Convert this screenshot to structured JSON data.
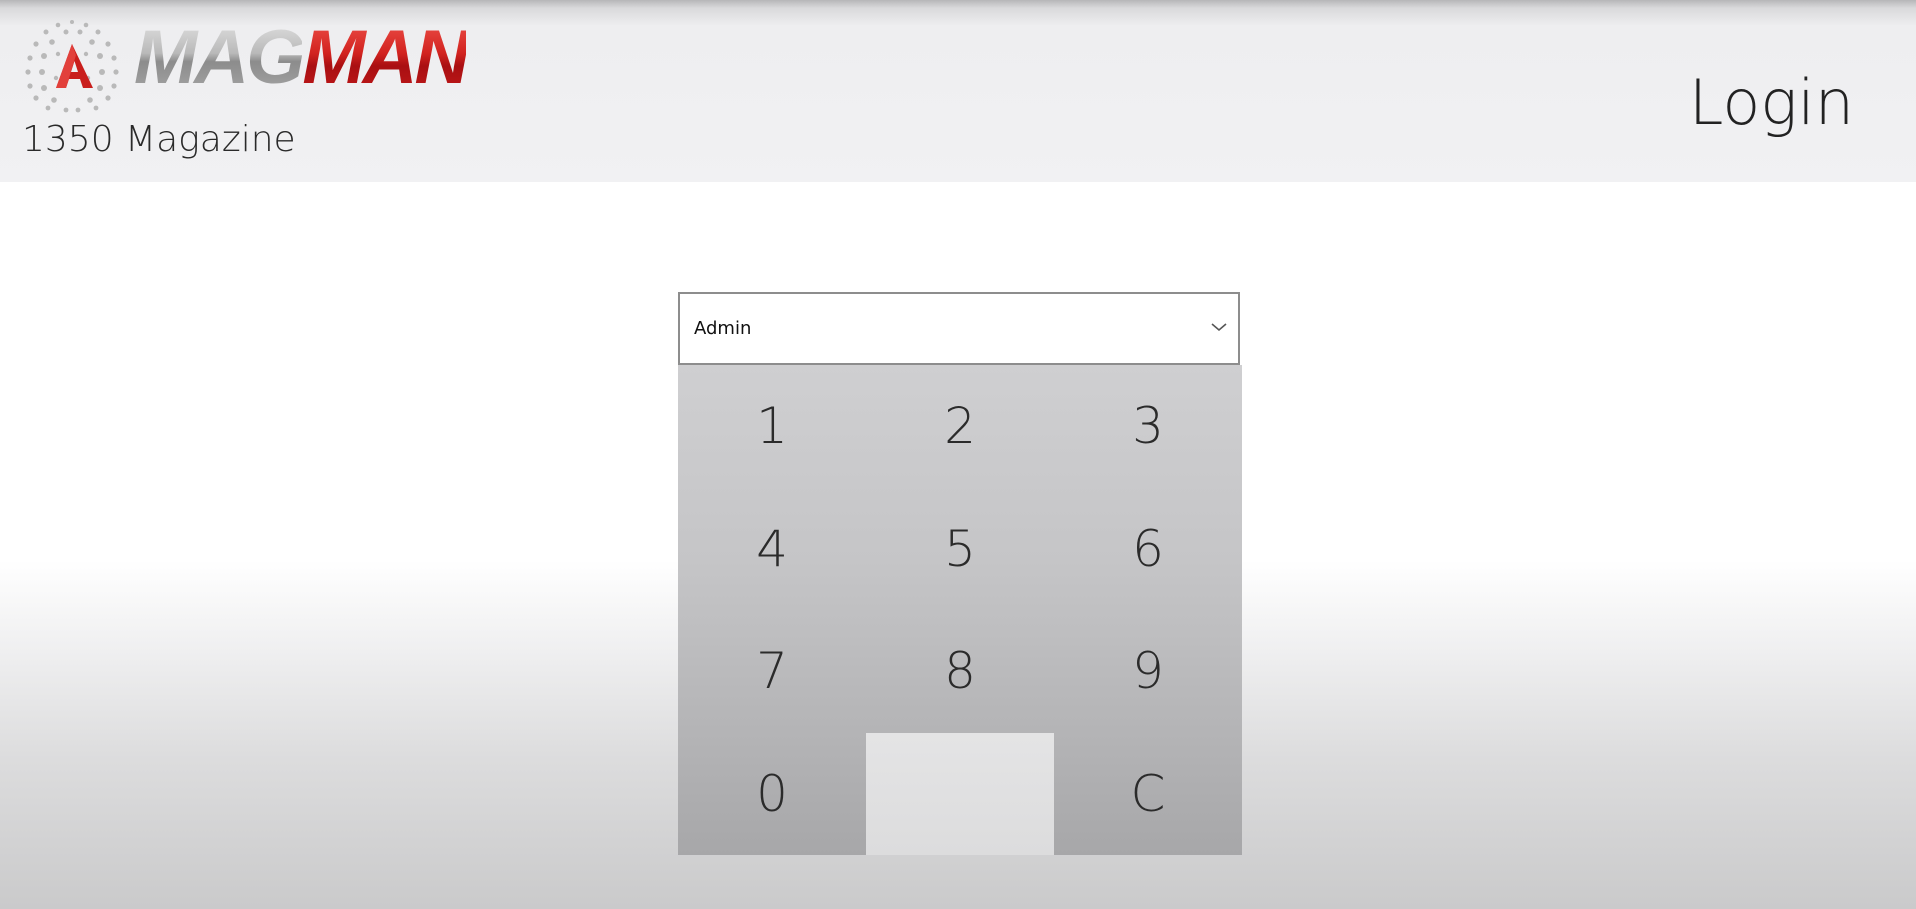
{
  "app": {
    "brand_mag": "MAG",
    "brand_man": "MAN",
    "logo_icon": "globe-a-icon",
    "subtitle": "1350 Magazine",
    "page_title": "Login"
  },
  "login": {
    "user_select": {
      "value": "Admin",
      "icon": "chevron-down-icon"
    },
    "keypad": {
      "keys": [
        "1",
        "2",
        "3",
        "4",
        "5",
        "6",
        "7",
        "8",
        "9",
        "0",
        "",
        "C"
      ]
    }
  },
  "colors": {
    "brand_red": "#d2231f",
    "brand_grey": "#9a9a9a",
    "keypad_bg": "#c3c3c5",
    "header_bg": "#f1f1f3"
  }
}
